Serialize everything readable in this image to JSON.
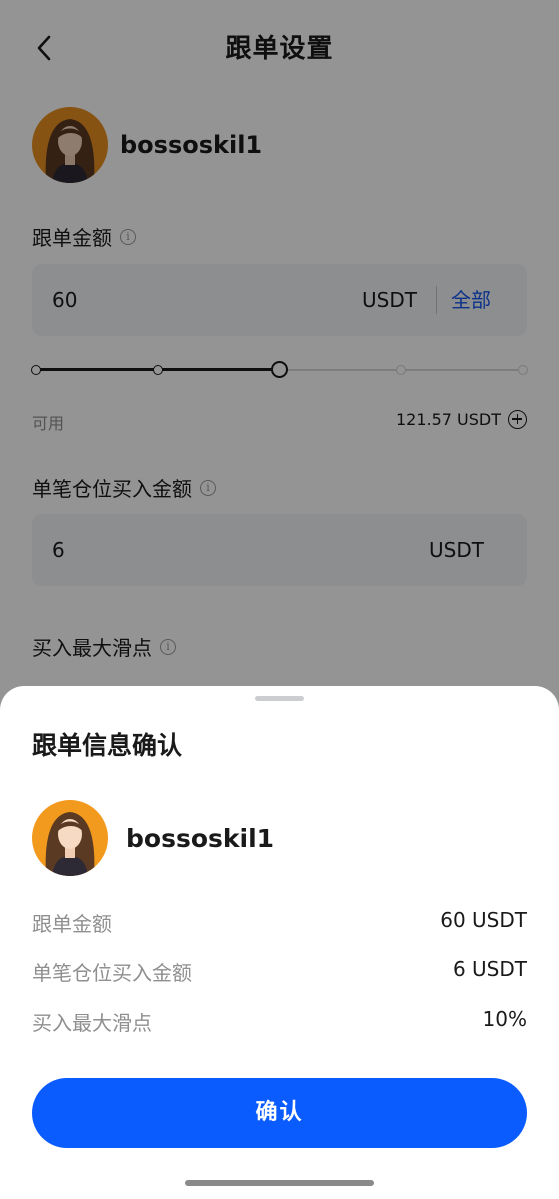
{
  "header": {
    "title": "跟单设置"
  },
  "trader": {
    "name": "bossoskil1"
  },
  "follow_amount": {
    "label": "跟单金额",
    "value": "60",
    "unit": "USDT",
    "all_label": "全部",
    "slider_level": 0.5,
    "slider_steps": [
      0,
      0.25,
      0.5,
      0.75,
      1
    ]
  },
  "available": {
    "label": "可用",
    "value": "121.57 USDT"
  },
  "per_position": {
    "label": "单笔仓位买入金额",
    "value": "6",
    "unit": "USDT"
  },
  "slippage": {
    "label": "买入最大滑点"
  },
  "sheet": {
    "title": "跟单信息确认",
    "trader_name": "bossoskil1",
    "rows": [
      {
        "label": "跟单金额",
        "value": "60 USDT"
      },
      {
        "label": "单笔仓位买入金额",
        "value": "6 USDT"
      },
      {
        "label": "买入最大滑点",
        "value": "10%"
      }
    ],
    "confirm_label": "确认"
  },
  "colors": {
    "accent": "#0a5cff",
    "link": "#1456f0",
    "avatar_bg": "#e8901f"
  }
}
